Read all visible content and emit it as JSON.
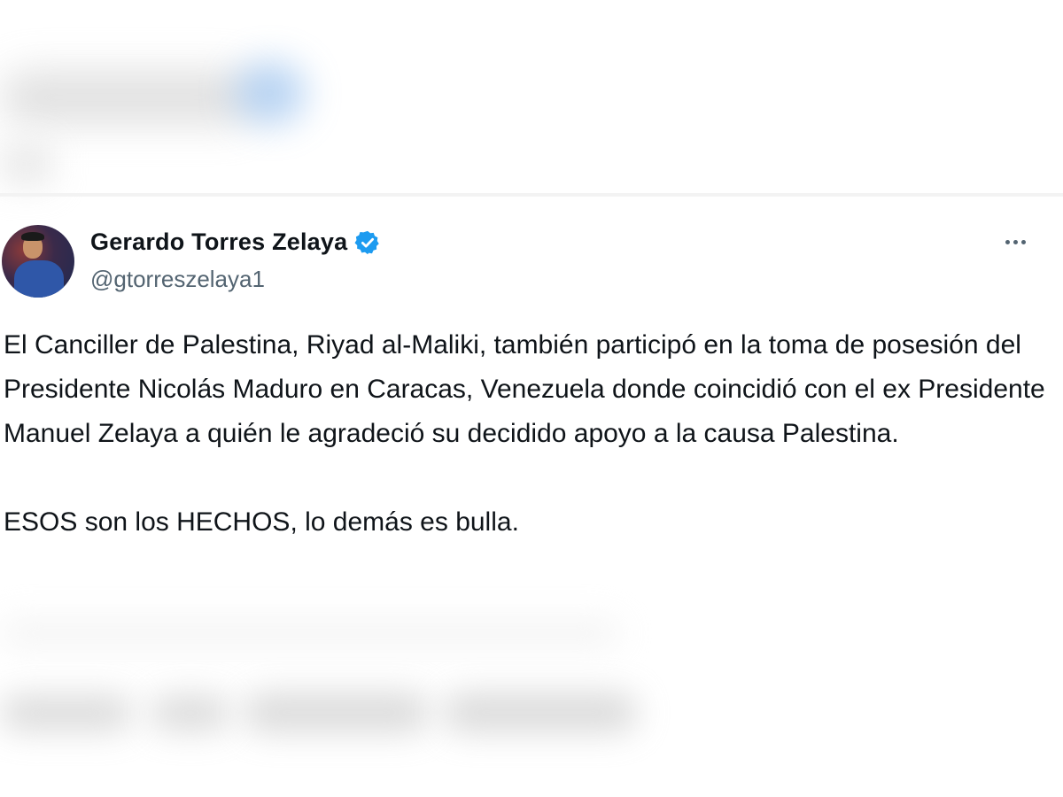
{
  "tweet": {
    "author": {
      "display_name": "Gerardo Torres Zelaya",
      "handle": "@gtorreszelaya1",
      "verified": true,
      "verified_color": "#1d9bf0"
    },
    "more_icon": "more-horizontal-icon",
    "body": [
      "El Canciller de Palestina, Riyad al-Maliki, también participó en la toma de posesión del Presidente Nicolás Maduro en Caracas, Venezuela donde coincidió con el ex Presidente Manuel Zelaya a quién le agradeció su decidido apoyo a la causa Palestina.",
      "ESOS son los HECHOS, lo demás es bulla."
    ]
  },
  "colors": {
    "text_primary": "#0f1419",
    "text_secondary": "#536471",
    "accent": "#1d9bf0"
  }
}
